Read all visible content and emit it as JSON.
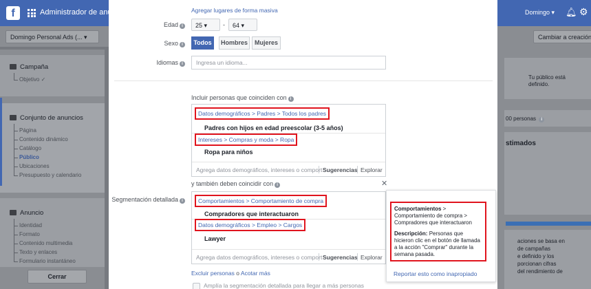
{
  "colors": {
    "brand": "#4267b2",
    "highlight_box": "#e0131d"
  },
  "topbar": {
    "logo": "f",
    "title": "Administrador de anunc",
    "user": "Domingo ▾",
    "bell_icon": "bell-icon",
    "gear_icon": "gear-icon"
  },
  "left_sidebar": {
    "account_select": "Domingo Personal Ads (... ▾",
    "campaign": {
      "title": "Campaña",
      "items": [
        "Objetivo ✓"
      ]
    },
    "adset": {
      "title": "Conjunto de anuncios",
      "items": [
        "Página",
        "Contenido dinámico",
        "Catálogo",
        "Público",
        "Ubicaciones",
        "Presupuesto y calendario"
      ]
    },
    "ad": {
      "title": "Anuncio",
      "items": [
        "Identidad",
        "Formato",
        "Contenido multimedia",
        "Texto y enlaces",
        "Formulario instantáneo"
      ]
    },
    "close_button": "Cerrar"
  },
  "right_sidebar": {
    "change_button": "Cambiar a creación",
    "audience_line1": "Tu público está",
    "audience_line2": "definido.",
    "people": "00 personas",
    "estimated": "stimados",
    "text_lines": [
      "aciones se basa en",
      "de campañas",
      "e definido y los",
      "porcionan cifras",
      "del rendimiento de"
    ]
  },
  "modal": {
    "bulk_link": "Agregar lugares de forma masiva",
    "age": {
      "label": "Edad",
      "min": "25 ▾",
      "dash": "-",
      "max": "64 ▾"
    },
    "sex": {
      "label": "Sexo",
      "options": [
        "Todos",
        "Hombres",
        "Mujeres"
      ]
    },
    "languages": {
      "label": "Idiomas",
      "placeholder": "Ingresa un idioma..."
    },
    "detailed": {
      "label": "Segmentación detallada",
      "include_header": "Incluir personas que coinciden con",
      "include_groups": [
        {
          "crumb": "Datos demográficos > Padres > Todos los padres",
          "item": "Padres con hijos en edad preescolar (3-5 años)"
        },
        {
          "crumb": "Intereses > Compras y moda > Ropa",
          "item": "Ropa para niños"
        }
      ],
      "narrow_header": "y también deben coincidir con",
      "narrow_groups": [
        {
          "crumb": "Comportamientos > Comportamiento de compra",
          "item": "Compradores que interactuaron"
        },
        {
          "crumb": "Datos demográficos > Empleo > Cargos",
          "item": "Lawyer"
        }
      ],
      "search_placeholder": "Agrega datos demográficos, intereses o comport",
      "suggestions": "Sugerencias",
      "explore": "Explorar",
      "exclude_link": "Excluir personas",
      "or": "o",
      "narrow_link": "Acotar más",
      "expand_checkbox": "Amplía la segmentación detallada para llegar a más personas"
    },
    "tooltip": {
      "title": "Comportamientos",
      "title_suffix": " >",
      "path": "Comportamiento de compra > Compradores que interactuaron",
      "desc_label": "Descripción:",
      "desc": " Personas que hicieron clic en el botón de llamada a la acción \"Comprar\" durante la semana pasada.",
      "report_link": "Reportar esto como inapropiado"
    }
  }
}
